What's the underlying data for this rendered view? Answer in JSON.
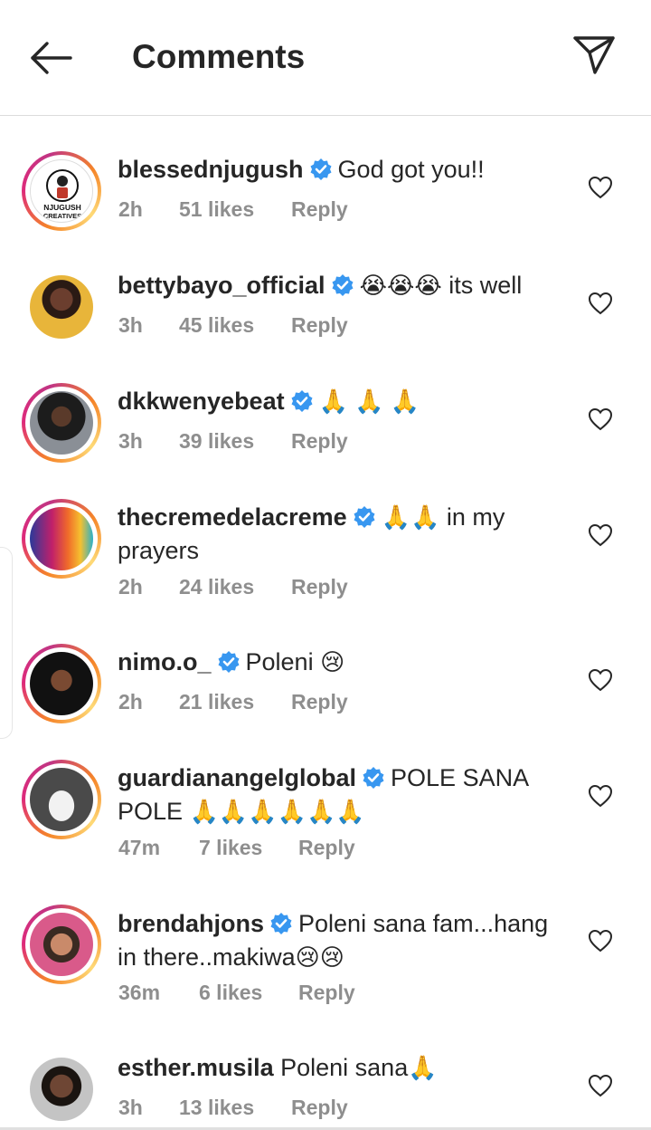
{
  "header": {
    "title": "Comments"
  },
  "comments": [
    {
      "user": "blessednjugush",
      "text": "God got you!!",
      "emoji": "",
      "text_after": "",
      "time": "2h",
      "likes": "51 likes",
      "reply": "Reply",
      "avatar_label": "NJUGUSH CREATIVES"
    },
    {
      "user": "bettybayo_official",
      "text": "",
      "emoji": "😭😭😭",
      "text_after": " its well",
      "time": "3h",
      "likes": "45 likes",
      "reply": "Reply"
    },
    {
      "user": "dkkwenyebeat",
      "text": "",
      "emoji": "🙏 🙏 🙏",
      "text_after": "",
      "time": "3h",
      "likes": "39 likes",
      "reply": "Reply"
    },
    {
      "user": "thecremedelacreme",
      "text": "",
      "emoji": "🙏🙏",
      "text_after": " in my prayers",
      "time": "2h",
      "likes": "24 likes",
      "reply": "Reply"
    },
    {
      "user": "nimo.o_",
      "text": "Poleni ",
      "emoji": "😢",
      "text_after": "",
      "time": "2h",
      "likes": "21 likes",
      "reply": "Reply"
    },
    {
      "user": "guardianangelglobal",
      "text": "POLE SANA POLE ",
      "emoji": "🙏🙏🙏🙏🙏🙏",
      "text_after": "",
      "time": "47m",
      "likes": "7 likes",
      "reply": "Reply"
    },
    {
      "user": "brendahjons",
      "text": "Poleni sana fam...hang in there..makiwa",
      "emoji": "😢😢",
      "text_after": "",
      "time": "36m",
      "likes": "6 likes",
      "reply": "Reply"
    },
    {
      "user": "esther.musila",
      "text": "Poleni sana",
      "emoji": "🙏",
      "text_after": "",
      "time": "3h",
      "likes": "13 likes",
      "reply": "Reply"
    }
  ],
  "colors": {
    "verified": "#3897f0",
    "meta": "#8e8e8e",
    "text": "#262626"
  },
  "icons": {
    "back": "arrow-left-icon",
    "send": "paper-plane-icon",
    "like": "heart-outline-icon",
    "verified": "verified-badge-icon"
  }
}
